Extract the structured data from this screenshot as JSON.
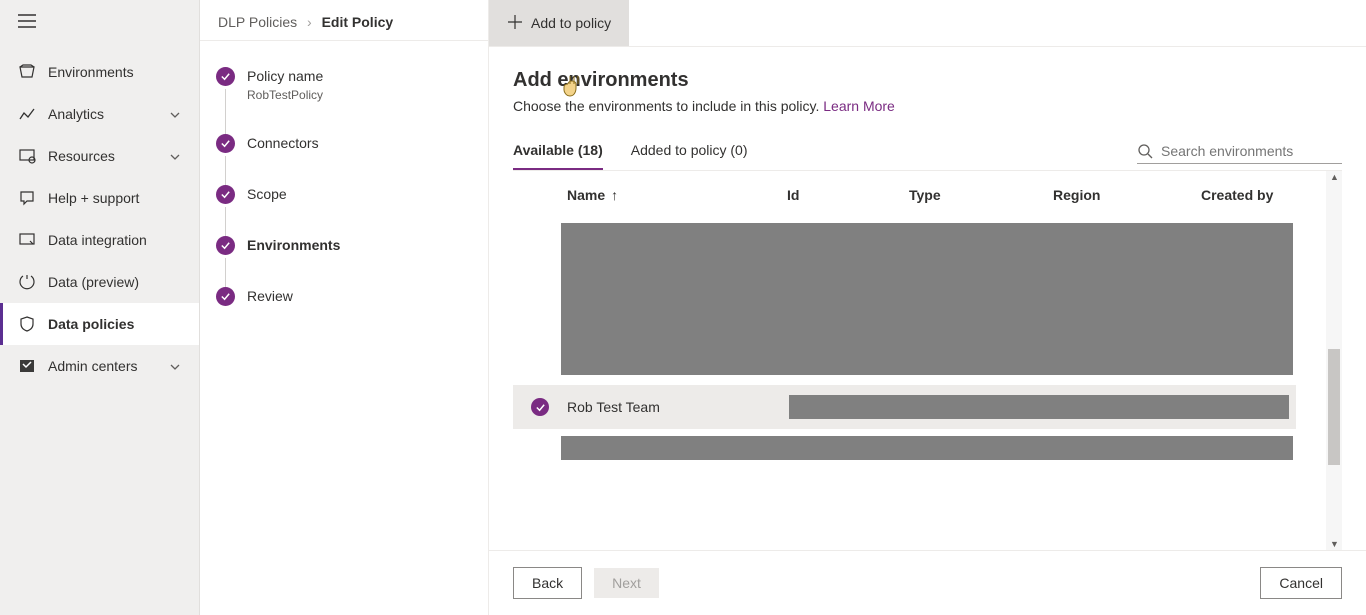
{
  "breadcrumb": {
    "root": "DLP Policies",
    "current": "Edit Policy"
  },
  "sidebar": {
    "items": [
      {
        "label": "Environments"
      },
      {
        "label": "Analytics"
      },
      {
        "label": "Resources"
      },
      {
        "label": "Help + support"
      },
      {
        "label": "Data integration"
      },
      {
        "label": "Data (preview)"
      },
      {
        "label": "Data policies"
      },
      {
        "label": "Admin centers"
      }
    ]
  },
  "steps": [
    {
      "title": "Policy name",
      "subtitle": "RobTestPolicy"
    },
    {
      "title": "Connectors"
    },
    {
      "title": "Scope"
    },
    {
      "title": "Environments"
    },
    {
      "title": "Review"
    }
  ],
  "toolbar": {
    "add_label": "Add to policy"
  },
  "heading": "Add environments",
  "description": "Choose the environments to include in this policy.",
  "learn_more": "Learn More",
  "tabs": {
    "available": "Available (18)",
    "added": "Added to policy (0)"
  },
  "search": {
    "placeholder": "Search environments"
  },
  "columns": {
    "name": "Name",
    "id": "Id",
    "type": "Type",
    "region": "Region",
    "created_by": "Created by"
  },
  "selected_row": {
    "name": "Rob Test Team"
  },
  "buttons": {
    "back": "Back",
    "next": "Next",
    "cancel": "Cancel"
  }
}
